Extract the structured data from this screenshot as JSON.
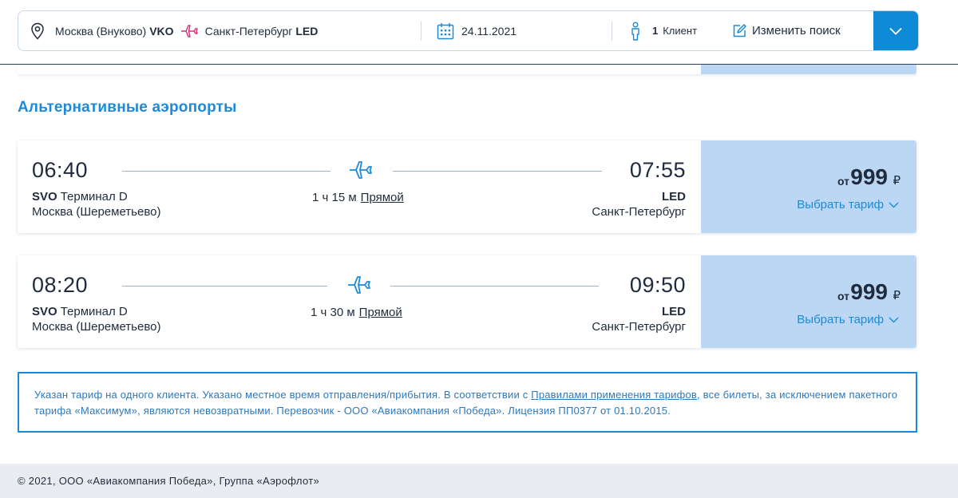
{
  "search": {
    "origin_city": "Москва (Внуково)",
    "origin_code": "VKO",
    "destination_city": "Санкт-Петербург",
    "destination_code": "LED",
    "date": "24.11.2021",
    "pax_count": "1",
    "pax_label": "Клиент",
    "edit_label": "Изменить поиск"
  },
  "section_title": "Альтернативные аэропорты",
  "flights": [
    {
      "dep_time": "06:40",
      "arr_time": "07:55",
      "dep_code": "SVO",
      "dep_terminal": "Терминал D",
      "dep_city": "Москва (Шереметьево)",
      "arr_code": "LED",
      "arr_city": "Санкт-Петербург",
      "duration": "1 ч 15 м",
      "direct": "Прямой",
      "price_from": "от",
      "price": "999",
      "currency": "₽",
      "choose": "Выбрать тариф"
    },
    {
      "dep_time": "08:20",
      "arr_time": "09:50",
      "dep_code": "SVO",
      "dep_terminal": "Терминал D",
      "dep_city": "Москва (Шереметьево)",
      "arr_code": "LED",
      "arr_city": "Санкт-Петербург",
      "duration": "1 ч 30 м",
      "direct": "Прямой",
      "price_from": "от",
      "price": "999",
      "currency": "₽",
      "choose": "Выбрать тариф"
    }
  ],
  "note": {
    "part1": "Указан тариф на одного клиента. Указано местное время отправления/прибытия. В соответствии с ",
    "link": "Правилами применения тарифов",
    "part2": ", все билеты, за исключением пакетного тарифа «Максимум», являются невозвратными. Перевозчик - ООО «Авиакомпания «Победа». Лицензия ПП0377 от 01.10.2015."
  },
  "footer": "© 2021, ООО «Авиакомпания Победа», Группа «Аэрофлот»",
  "colors": {
    "accent": "#1c8ad8",
    "price_bg": "#bcd7f4",
    "toggle_bg": "#0e8ad6",
    "pink": "#e0287a"
  },
  "icons": {
    "location": "map-pin-icon",
    "route": "plane-icon",
    "date": "calendar-icon",
    "pax": "person-icon",
    "edit": "pencil-icon",
    "toggle": "chevron-down-icon"
  }
}
